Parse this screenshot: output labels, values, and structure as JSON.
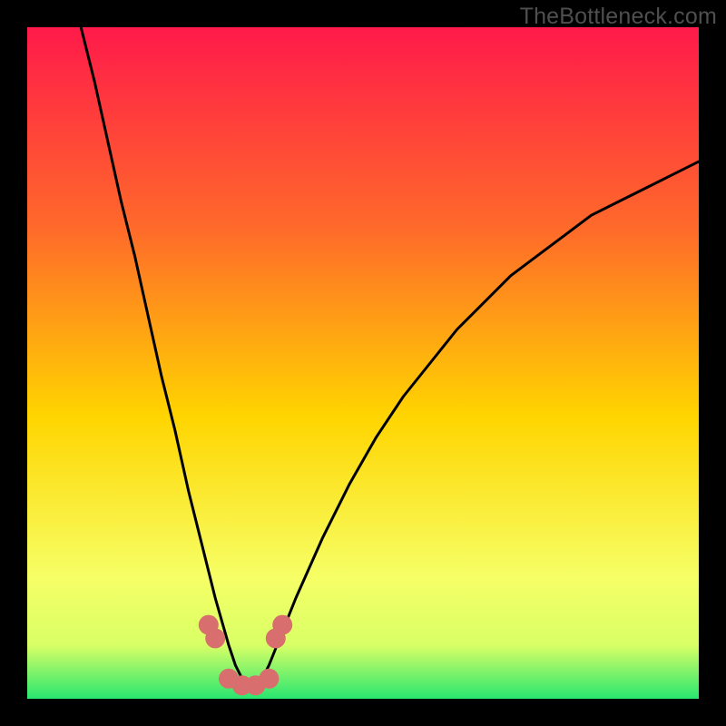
{
  "watermark": "TheBottleneck.com",
  "colors": {
    "frame": "#000000",
    "grad_top": "#ff1a4a",
    "grad_mid1": "#ff6a2a",
    "grad_mid2": "#ffd500",
    "grad_mid3": "#f6ff66",
    "grad_low": "#d9ff66",
    "grad_green": "#28e66f",
    "curve": "#000000",
    "marker": "#d96e6e"
  },
  "chart_data": {
    "type": "line",
    "title": "",
    "xlabel": "",
    "ylabel": "",
    "xlim": [
      0,
      100
    ],
    "ylim": [
      0,
      100
    ],
    "series": [
      {
        "name": "bottleneck-curve",
        "x": [
          8,
          10,
          12,
          14,
          16,
          18,
          20,
          22,
          24,
          26,
          28,
          30,
          31,
          32,
          33,
          34,
          35,
          36,
          38,
          40,
          44,
          48,
          52,
          56,
          60,
          64,
          68,
          72,
          76,
          80,
          84,
          88,
          92,
          96,
          100
        ],
        "y": [
          100,
          92,
          83,
          74,
          66,
          57,
          48,
          40,
          31,
          23,
          15,
          8,
          5,
          3,
          2,
          2,
          3,
          5,
          10,
          15,
          24,
          32,
          39,
          45,
          50,
          55,
          59,
          63,
          66,
          69,
          72,
          74,
          76,
          78,
          80
        ]
      }
    ],
    "markers": {
      "name": "trough-markers",
      "x": [
        27,
        28,
        30,
        32,
        34,
        36,
        37,
        38
      ],
      "y": [
        11,
        9,
        3,
        2,
        2,
        3,
        9,
        11
      ]
    },
    "gradient_stops": [
      {
        "offset": 0.0,
        "color": "#ff1a4a"
      },
      {
        "offset": 0.3,
        "color": "#ff6a2a"
      },
      {
        "offset": 0.58,
        "color": "#ffd500"
      },
      {
        "offset": 0.82,
        "color": "#f6ff66"
      },
      {
        "offset": 0.92,
        "color": "#d9ff66"
      },
      {
        "offset": 1.0,
        "color": "#28e66f"
      }
    ]
  }
}
